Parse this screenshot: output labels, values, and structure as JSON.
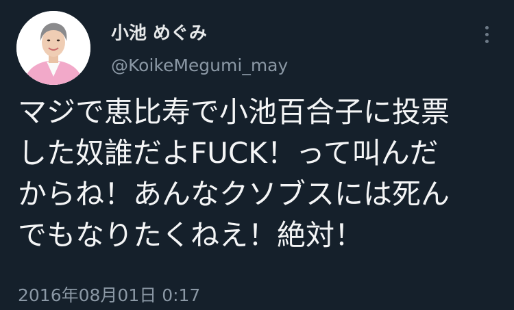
{
  "tweet": {
    "display_name": "小池 めぐみ",
    "handle": "@KoikeMegumi_may",
    "more_icon": "more-vertical-icon",
    "text_lines": [
      "マジで恵比寿で小池百合子に投票",
      "した奴誰だよFUCK！って叫んだ",
      "からね！あんなクソブスには死ん",
      "でもなりたくねえ！絶対！"
    ],
    "timestamp": "2016年08月01日 0:17"
  },
  "colors": {
    "background": "#15202b",
    "primary_text": "#e7e9ea",
    "secondary_text": "#8b98a5",
    "avatar_jacket": "#f2a9c9"
  }
}
